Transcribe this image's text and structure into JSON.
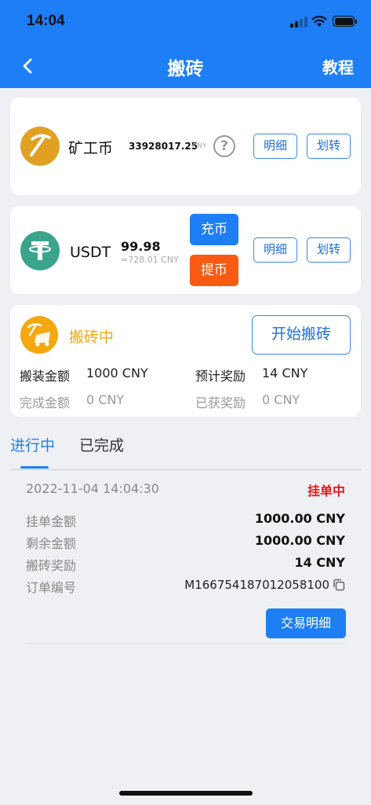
{
  "status": {
    "time": "14:04"
  },
  "nav": {
    "title": "搬砖",
    "action": "教程"
  },
  "miner": {
    "name": "矿工币",
    "amount": "33928017.25",
    "unit": "CNY",
    "help": "?",
    "detail_label": "明细",
    "transfer_label": "划转"
  },
  "usdt": {
    "name": "USDT",
    "amount": "99.98",
    "approx": "≈728.01 CNY",
    "deposit_label": "充币",
    "withdraw_label": "提币",
    "detail_label": "明细",
    "transfer_label": "划转"
  },
  "task": {
    "status": "搬砖中",
    "start_label": "开始搬砖",
    "stats": [
      {
        "label": "搬装金额",
        "value": "1000 CNY"
      },
      {
        "label": "预计奖励",
        "value": "14 CNY"
      },
      {
        "label": "完成金额",
        "value": "0 CNY"
      },
      {
        "label": "已获奖励",
        "value": "0 CNY"
      }
    ]
  },
  "tabs": [
    {
      "label": "进行中",
      "active": true
    },
    {
      "label": "已完成",
      "active": false
    }
  ],
  "order": {
    "date": "2022-11-04 14:04:30",
    "status": "挂单中",
    "rows": [
      {
        "label": "挂单金额",
        "value": "1000.00 CNY"
      },
      {
        "label": "剩余金额",
        "value": "1000.00 CNY"
      },
      {
        "label": "搬砖奖励",
        "value": "14 CNY"
      },
      {
        "label": "订单编号",
        "value": "M166754187012058100"
      }
    ],
    "detail_label": "交易明细"
  },
  "colors": {
    "primary": "#1e7ef6",
    "orange": "#fb5a12",
    "gold": "#e0a123",
    "tether": "#3aa58c",
    "status_red": "#e31b1b"
  }
}
